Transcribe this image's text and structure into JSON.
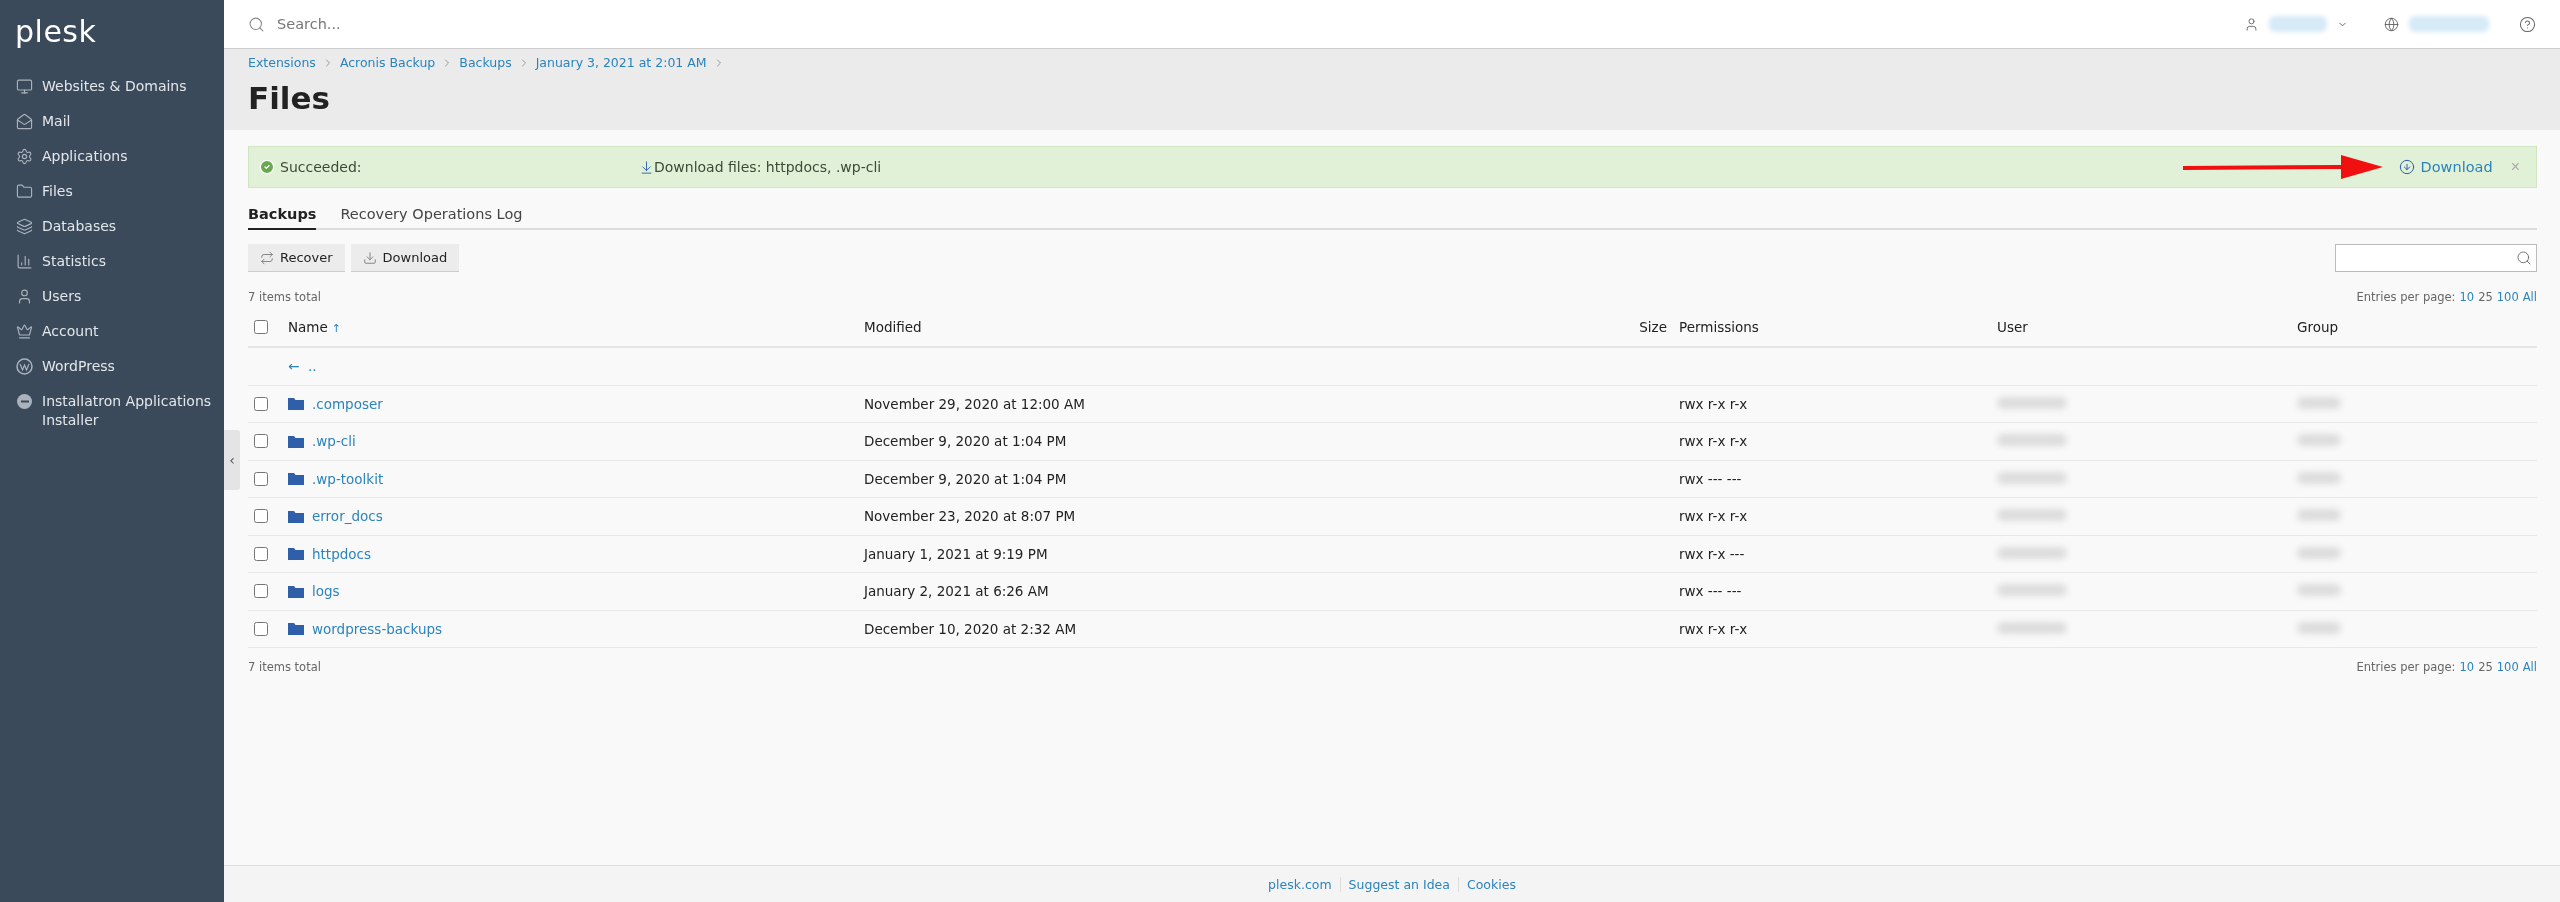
{
  "sidebar": {
    "logo": "plesk",
    "items": [
      {
        "label": "Websites & Domains"
      },
      {
        "label": "Mail"
      },
      {
        "label": "Applications"
      },
      {
        "label": "Files"
      },
      {
        "label": "Databases"
      },
      {
        "label": "Statistics"
      },
      {
        "label": "Users"
      },
      {
        "label": "Account"
      },
      {
        "label": "WordPress"
      },
      {
        "label": "Installatron Applications Installer"
      }
    ],
    "collapse_handle": "‹"
  },
  "header": {
    "search_placeholder": "Search..."
  },
  "breadcrumbs": [
    "Extensions",
    "Acronis Backup",
    "Backups",
    "January 3, 2021 at 2:01 AM"
  ],
  "title": "Files",
  "alert": {
    "status": "Succeeded:",
    "message": "Download files: httpdocs, .wp-cli",
    "action": "Download",
    "close": "×"
  },
  "tabs": [
    {
      "label": "Backups",
      "selected": true
    },
    {
      "label": "Recovery Operations Log",
      "selected": false
    }
  ],
  "toolbar": {
    "buttons": [
      "Recover",
      "Download"
    ]
  },
  "items_total": "7 items total",
  "entries_top": {
    "label": "Entries per page:",
    "options": [
      {
        "label": "10",
        "selected": false
      },
      {
        "label": "25",
        "selected": true
      },
      {
        "label": "100",
        "selected": false
      },
      {
        "label": "All",
        "selected": false
      }
    ]
  },
  "table": {
    "select_all_checked": false,
    "columns": [
      {
        "label": "Name",
        "sort": "↑"
      },
      {
        "label": "Modified"
      },
      {
        "label": "Size"
      },
      {
        "label": "Permissions"
      },
      {
        "label": "User"
      },
      {
        "label": "Group"
      }
    ],
    "parent_row": {
      "arrow": "←",
      "label": ".."
    },
    "rows": [
      {
        "name": ".composer",
        "modified": "November 29, 2020 at 12:00 AM",
        "permissions": "rwx r-x r-x",
        "checked": false
      },
      {
        "name": ".wp-cli",
        "modified": "December 9, 2020 at 1:04 PM",
        "permissions": "rwx r-x r-x",
        "checked": false
      },
      {
        "name": ".wp-toolkit",
        "modified": "December 9, 2020 at 1:04 PM",
        "permissions": "rwx --- ---",
        "checked": false
      },
      {
        "name": "error_docs",
        "modified": "November 23, 2020 at 8:07 PM",
        "permissions": "rwx r-x r-x",
        "checked": false
      },
      {
        "name": "httpdocs",
        "modified": "January 1, 2021 at 9:19 PM",
        "permissions": "rwx r-x ---",
        "checked": false
      },
      {
        "name": "logs",
        "modified": "January 2, 2021 at 6:26 AM",
        "permissions": "rwx --- ---",
        "checked": false
      },
      {
        "name": "wordpress-backups",
        "modified": "December 10, 2020 at 2:32 AM",
        "permissions": "rwx r-x r-x",
        "checked": false
      }
    ]
  },
  "items_total_bottom": "7 items total",
  "entries_bottom": {
    "label": "Entries per page:",
    "options": [
      {
        "label": "10",
        "selected": false
      },
      {
        "label": "25",
        "selected": true
      },
      {
        "label": "100",
        "selected": false
      },
      {
        "label": "All",
        "selected": false
      }
    ]
  },
  "footer": {
    "links": [
      "plesk.com",
      "Suggest an Idea",
      "Cookies"
    ]
  }
}
